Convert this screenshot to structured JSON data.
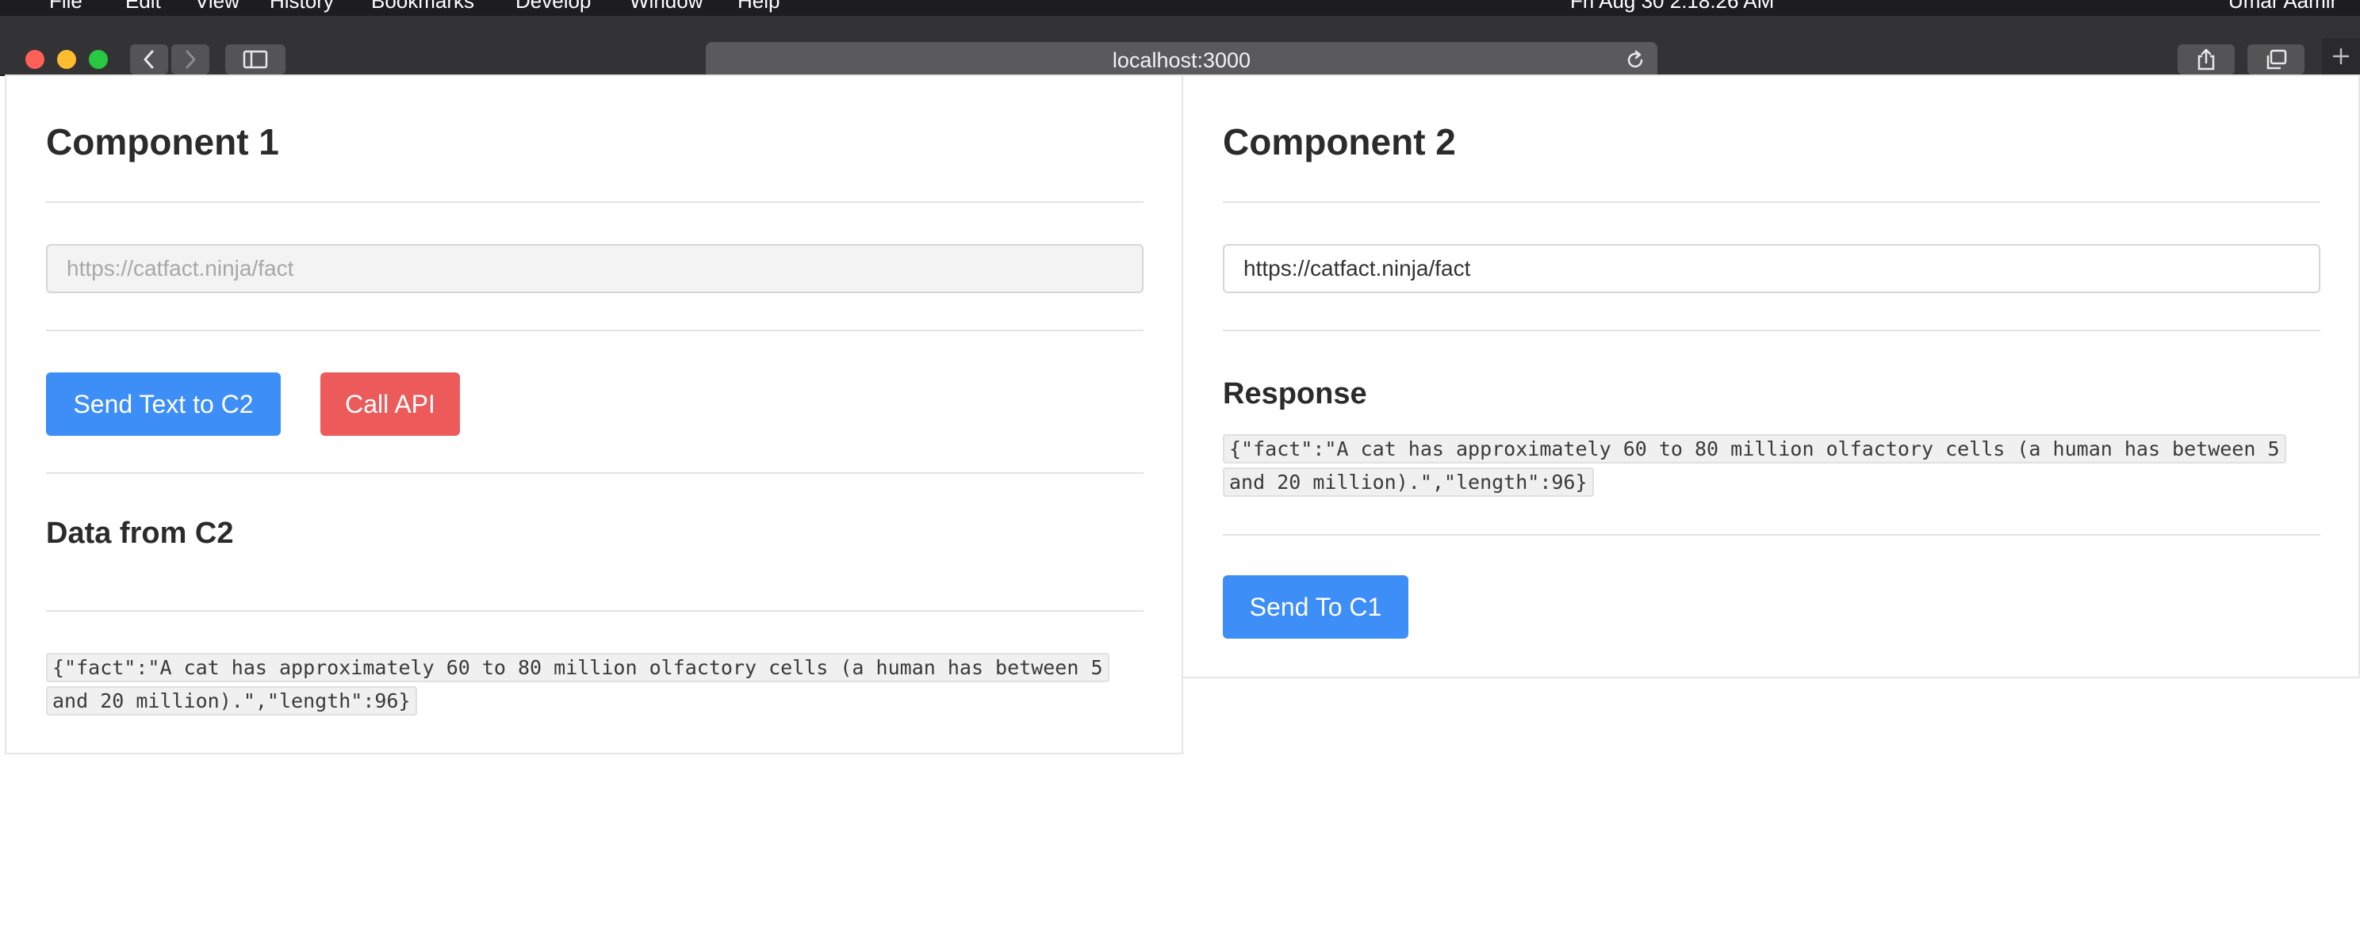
{
  "menubar": {
    "items": [
      "File",
      "Edit",
      "View",
      "History",
      "Bookmarks",
      "Develop",
      "Window",
      "Help"
    ],
    "clock": "Fri Aug 30  2:18:26 AM",
    "user": "Umar Aamir"
  },
  "browser": {
    "url": "localhost:3000",
    "icons": [
      "back-icon",
      "forward-icon",
      "sidebar-icon",
      "reload-icon",
      "share-icon",
      "tabs-icon",
      "plus-icon"
    ]
  },
  "component1": {
    "title": "Component 1",
    "input_placeholder": "https://catfact.ninja/fact",
    "send_button": "Send Text to C2",
    "call_api_button": "Call API",
    "data_heading": "Data from C2",
    "data_json": "{\"fact\":\"A cat has approximately 60 to 80 million olfactory cells (a human has between 5 and 20 million).\",\"length\":96}"
  },
  "component2": {
    "title": "Component 2",
    "input_value": "https://catfact.ninja/fact",
    "response_heading": "Response",
    "response_json": "{\"fact\":\"A cat has approximately 60 to 80 million olfactory cells (a human has between 5 and 20 million).\",\"length\":96}",
    "send_button": "Send To C1"
  },
  "colors": {
    "primary": "#3e8ef7",
    "danger": "#ec5a5a",
    "chrome": "#333336"
  }
}
